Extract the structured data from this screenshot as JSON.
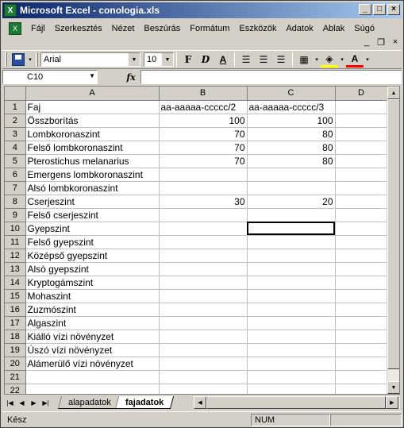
{
  "window": {
    "title": "Microsoft Excel - conologia.xls",
    "minimize": "_",
    "maximize": "□",
    "close": "×"
  },
  "menu": [
    "Fájl",
    "Szerkesztés",
    "Nézet",
    "Beszúrás",
    "Formátum",
    "Eszközök",
    "Adatok",
    "Ablak",
    "Súgó"
  ],
  "toolbar": {
    "font": "Arial",
    "size": "10",
    "bold": "F",
    "italic": "D",
    "underline": "A",
    "font_color_label": "A"
  },
  "formula_bar": {
    "name_box": "C10",
    "fx": "fx",
    "value": ""
  },
  "sheet": {
    "columns": [
      "A",
      "B",
      "C",
      "D"
    ],
    "selected_column": "C",
    "selected_row": 10,
    "rows": [
      {
        "n": "1",
        "a": "Faj",
        "b": "aa-aaaaa-ccccc/2",
        "c": "aa-aaaaa-ccccc/3",
        "d": ""
      },
      {
        "n": "2",
        "a": "Összborítás",
        "b": "100",
        "c": "100",
        "d": ""
      },
      {
        "n": "3",
        "a": "Lombkoronaszint",
        "b": "70",
        "c": "80",
        "d": ""
      },
      {
        "n": "4",
        "a": "Felső lombkoronaszint",
        "b": "70",
        "c": "80",
        "d": ""
      },
      {
        "n": "5",
        "a": "Pterostichus melanarius",
        "b": "70",
        "c": "80",
        "d": ""
      },
      {
        "n": "6",
        "a": "Emergens lombkoronaszint",
        "b": "",
        "c": "",
        "d": ""
      },
      {
        "n": "7",
        "a": "Alsó lombkoronaszint",
        "b": "",
        "c": "",
        "d": ""
      },
      {
        "n": "8",
        "a": "Cserjeszint",
        "b": "30",
        "c": "20",
        "d": ""
      },
      {
        "n": "9",
        "a": "Felső cserjeszint",
        "b": "",
        "c": "",
        "d": ""
      },
      {
        "n": "10",
        "a": "Gyepszint",
        "b": "",
        "c": "",
        "d": ""
      },
      {
        "n": "11",
        "a": "Felső gyepszint",
        "b": "",
        "c": "",
        "d": ""
      },
      {
        "n": "12",
        "a": "Középső gyepszint",
        "b": "",
        "c": "",
        "d": ""
      },
      {
        "n": "13",
        "a": "Alsó gyepszint",
        "b": "",
        "c": "",
        "d": ""
      },
      {
        "n": "14",
        "a": "Kryptogámszint",
        "b": "",
        "c": "",
        "d": ""
      },
      {
        "n": "15",
        "a": "Mohaszint",
        "b": "",
        "c": "",
        "d": ""
      },
      {
        "n": "16",
        "a": "Zuzmószint",
        "b": "",
        "c": "",
        "d": ""
      },
      {
        "n": "17",
        "a": "Algaszint",
        "b": "",
        "c": "",
        "d": ""
      },
      {
        "n": "18",
        "a": "Kiálló vízi növényzet",
        "b": "",
        "c": "",
        "d": ""
      },
      {
        "n": "19",
        "a": "Úszó vízi növényzet",
        "b": "",
        "c": "",
        "d": ""
      },
      {
        "n": "20",
        "a": "Alámerülő vízi növényzet",
        "b": "",
        "c": "",
        "d": ""
      },
      {
        "n": "21",
        "a": "",
        "b": "",
        "c": "",
        "d": ""
      },
      {
        "n": "22",
        "a": "",
        "b": "",
        "c": "",
        "d": ""
      }
    ]
  },
  "tabs": [
    "alapadatok",
    "fajadatok"
  ],
  "active_tab": "fajadatok",
  "status": {
    "text": "Kész",
    "num": "NUM"
  }
}
